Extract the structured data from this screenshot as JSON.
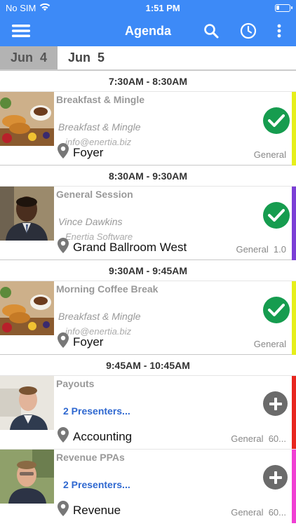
{
  "status_bar": {
    "carrier": "No SIM",
    "time": "1:51 PM",
    "icons": [
      "wifi-icon",
      "battery-icon"
    ]
  },
  "nav": {
    "title": "Agenda",
    "icons": [
      "menu-icon",
      "search-icon",
      "clock-icon",
      "more-vert-icon"
    ]
  },
  "dates": [
    {
      "label": "Jun  4",
      "selected": true
    },
    {
      "label": "Jun  5",
      "selected": false
    }
  ],
  "colors": {
    "nav_blue": "#3d8af7",
    "check_green": "#169c4f",
    "add_gray": "#6b6b6b",
    "link_blue": "#2f68d0"
  },
  "time_slots": [
    {
      "time": "7:30AM - 8:30AM",
      "session": {
        "title": "Breakfast & Mingle",
        "presenter": "Breakfast & Mingle",
        "company": "info@enertia.biz",
        "location": "Foyer",
        "track": "General",
        "status": "check-icon",
        "bar_color": "#e6ef1a",
        "image": "breakfast-image"
      }
    },
    {
      "time": "8:30AM - 9:30AM",
      "session": {
        "title": "General Session",
        "presenter": "Vince Dawkins",
        "company": "Enertia Software",
        "location": "Grand Ballroom West",
        "track": "General  1.0",
        "status": "check-icon",
        "bar_color": "#7b3fd6",
        "image": "speaker-photo"
      }
    },
    {
      "time": "9:30AM - 9:45AM",
      "session": {
        "title": "Morning Coffee Break",
        "presenter": "Breakfast & Mingle",
        "company": "info@enertia.biz",
        "location": "Foyer",
        "track": "General",
        "status": "check-icon",
        "bar_color": "#e6ef1a",
        "image": "breakfast-image"
      }
    },
    {
      "time": "9:45AM - 10:45AM",
      "sessions": [
        {
          "title": "Payouts",
          "presenters_link": "2 Presenters...",
          "location": "Accounting",
          "track": "General  60...",
          "status": "add-icon",
          "bar_color": "#e8261f",
          "image": "presenter-photo"
        },
        {
          "title": "Revenue PPAs",
          "presenters_link": "2 Presenters...",
          "location": "Revenue",
          "track": "General  60...",
          "status": "add-icon",
          "bar_color": "#f03fd3",
          "image": "presenter-photo"
        }
      ]
    }
  ]
}
